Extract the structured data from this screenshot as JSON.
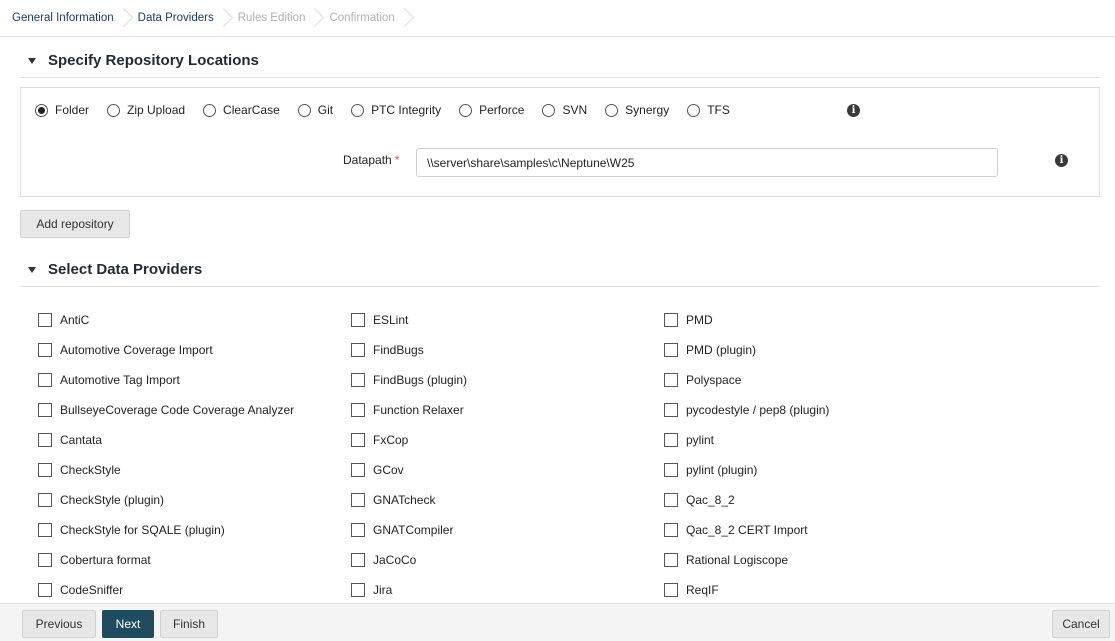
{
  "breadcrumb": [
    {
      "label": "General Information",
      "enabled": true
    },
    {
      "label": "Data Providers",
      "enabled": true
    },
    {
      "label": "Rules Edition",
      "enabled": false
    },
    {
      "label": "Confirmation",
      "enabled": false
    }
  ],
  "repo_section": {
    "title": "Specify Repository Locations",
    "options": [
      "Folder",
      "Zip Upload",
      "ClearCase",
      "Git",
      "PTC Integrity",
      "Perforce",
      "SVN",
      "Synergy",
      "TFS"
    ],
    "selected": "Folder",
    "datapath_label": "Datapath",
    "datapath_required_mark": "*",
    "datapath_value": "\\\\server\\share\\samples\\c\\Neptune\\W25",
    "info_glyph": "i",
    "add_repository": "Add repository"
  },
  "providers_section": {
    "title": "Select Data Providers",
    "columns": [
      [
        "AntiC",
        "Automotive Coverage Import",
        "Automotive Tag Import",
        "BullseyeCoverage Code Coverage Analyzer",
        "Cantata",
        "CheckStyle",
        "CheckStyle (plugin)",
        "CheckStyle for SQALE (plugin)",
        "Cobertura format",
        "CodeSniffer"
      ],
      [
        "ESLint",
        "FindBugs",
        "FindBugs (plugin)",
        "Function Relaxer",
        "FxCop",
        "GCov",
        "GNATcheck",
        "GNATCompiler",
        "JaCoCo",
        "Jira"
      ],
      [
        "PMD",
        "PMD (plugin)",
        "Polyspace",
        "pycodestyle / pep8 (plugin)",
        "pylint",
        "pylint (plugin)",
        "Qac_8_2",
        "Qac_8_2 CERT Import",
        "Rational Logiscope",
        "ReqIF"
      ]
    ]
  },
  "footer": {
    "previous": "Previous",
    "next": "Next",
    "finish": "Finish",
    "cancel": "Cancel"
  },
  "colors": {
    "primary_button": "#1f4d5f",
    "required_mark": "#d9534f"
  }
}
